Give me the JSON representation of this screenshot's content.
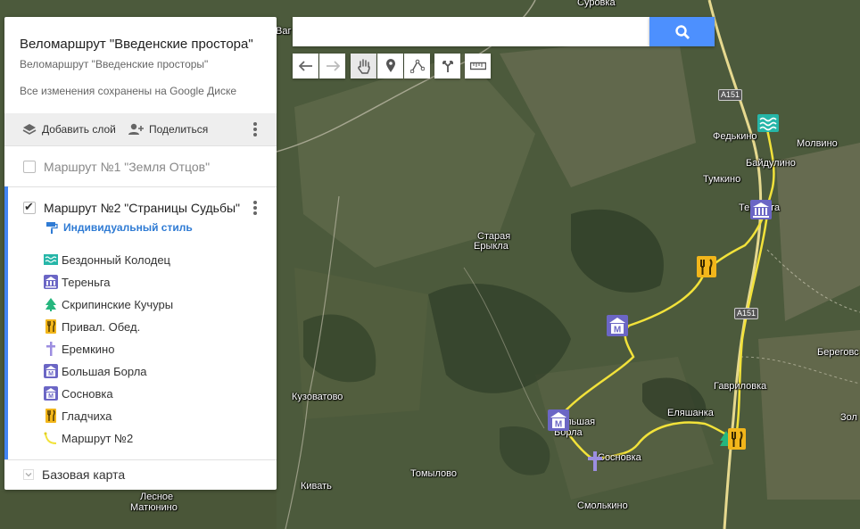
{
  "map": {
    "places": [
      {
        "name": "Суровка"
      },
      {
        "name": "Ваг"
      },
      {
        "name": "Федькино"
      },
      {
        "name": "Молвино"
      },
      {
        "name": "Байдулино"
      },
      {
        "name": "Тумкино"
      },
      {
        "name": "Тереньга"
      },
      {
        "name": "Старая"
      },
      {
        "name": "Ерыкла"
      },
      {
        "name": "Кузоватово"
      },
      {
        "name": "Гавриловка"
      },
      {
        "name": "Береговс"
      },
      {
        "name": "Еляшанка"
      },
      {
        "name": "Большая"
      },
      {
        "name": "Борла"
      },
      {
        "name": "Сосновка"
      },
      {
        "name": "Томылово"
      },
      {
        "name": "Кивать"
      },
      {
        "name": "Лесное"
      },
      {
        "name": "Матюнино"
      },
      {
        "name": "Смолькино"
      },
      {
        "name": "Зол"
      }
    ],
    "road_shields": [
      "A151",
      "A151"
    ]
  },
  "panel": {
    "title": "Веломаршрут \"Введенские простора\"",
    "subtitle": "Веломаршрут \"Введенские просторы\"",
    "saved_status": "Все изменения сохранены на Google Диске",
    "add_layer": "Добавить слой",
    "share": "Поделиться",
    "layers": [
      {
        "name": "Маршрут №1 \"Земля Отцов\"",
        "checked": false
      },
      {
        "name": "Маршрут №2 \"Страницы Судьбы\"",
        "checked": true
      }
    ],
    "style_link": "Индивидуальный стиль",
    "features": [
      {
        "label": "Бездонный Колодец",
        "icon": "water-icon"
      },
      {
        "label": "Тереньга",
        "icon": "museum-icon"
      },
      {
        "label": "Скрипинские Кучуры",
        "icon": "tree-icon"
      },
      {
        "label": "Привал. Обед.",
        "icon": "restaurant-icon"
      },
      {
        "label": "Еремкино",
        "icon": "cross-icon"
      },
      {
        "label": "Большая Борла",
        "icon": "monument-icon"
      },
      {
        "label": "Сосновка",
        "icon": "monument-icon"
      },
      {
        "label": "Гладчиха",
        "icon": "restaurant-icon"
      },
      {
        "label": "Маршрут №2",
        "icon": "route-line-icon"
      }
    ],
    "basemap": "Базовая карта"
  },
  "search": {
    "placeholder": "",
    "value": ""
  },
  "colors": {
    "accent": "#4285f4",
    "route": "#f2e23a",
    "search_button": "#4d90fe"
  }
}
